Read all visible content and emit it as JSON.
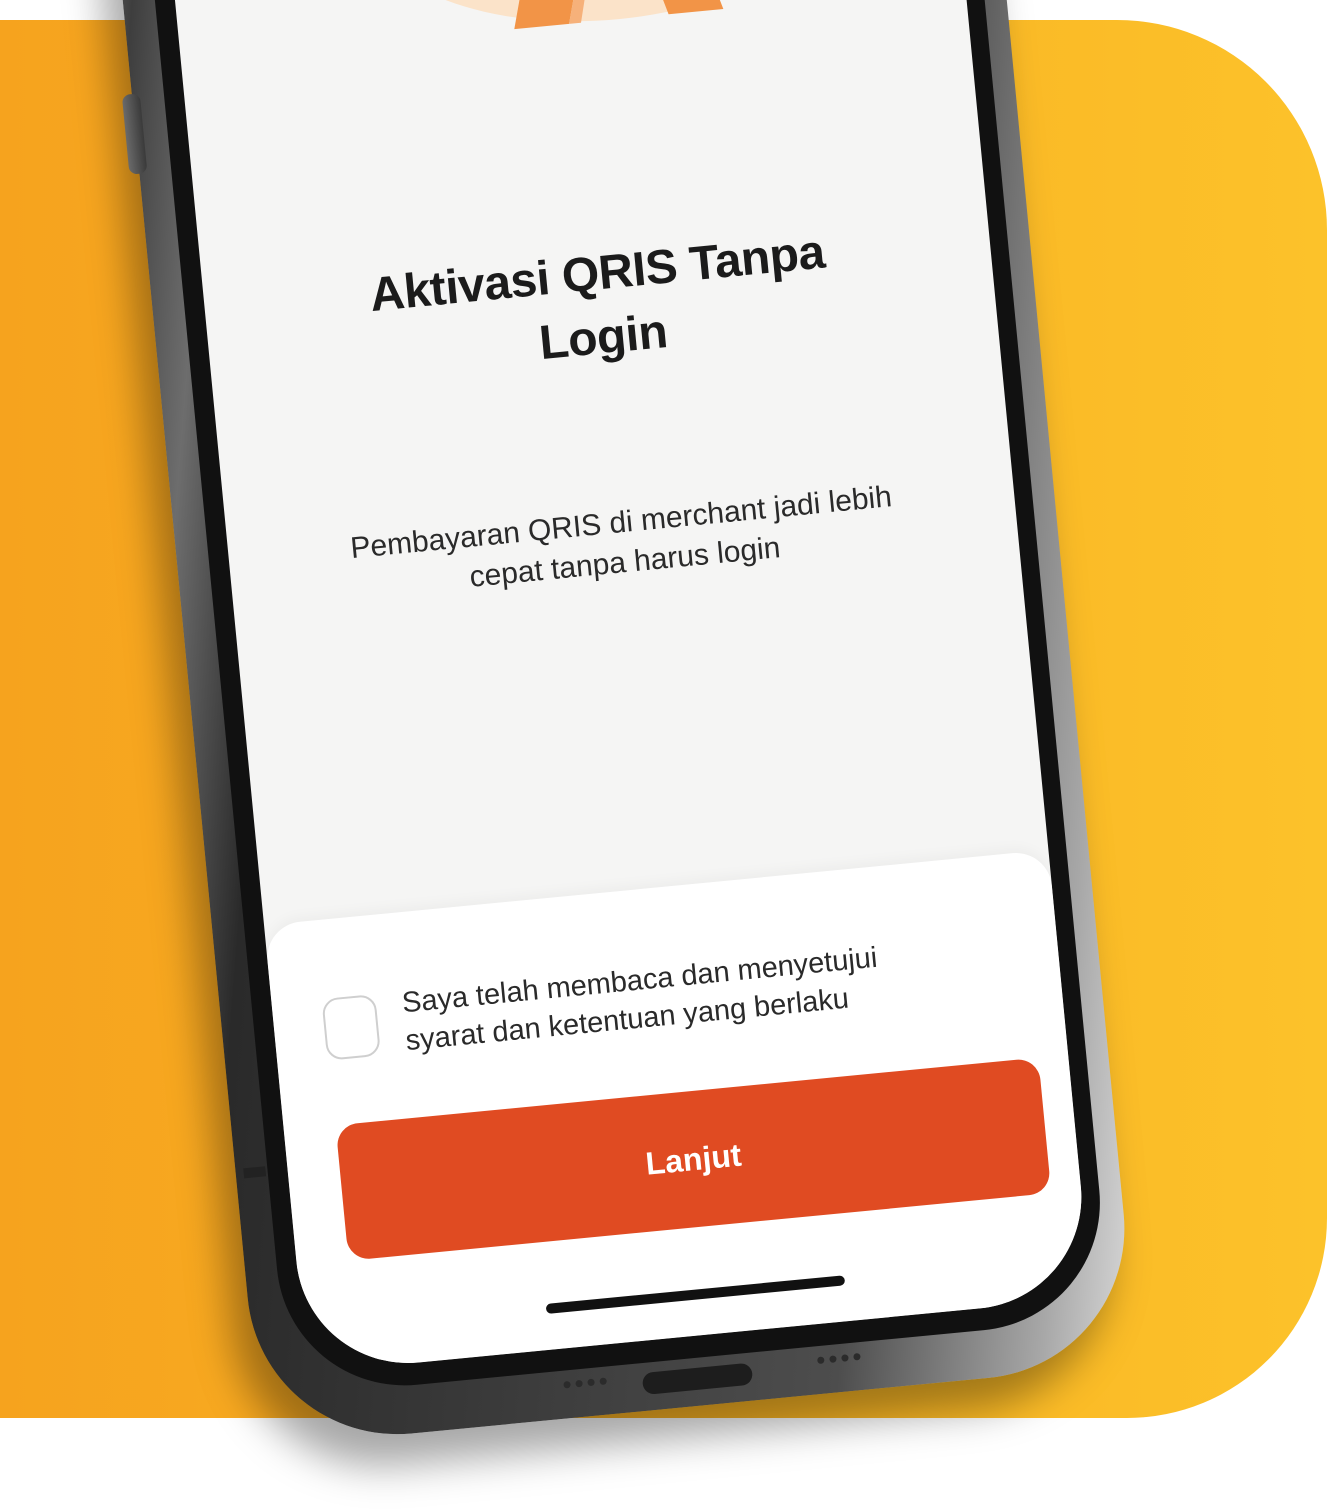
{
  "screen": {
    "title_lines": [
      "Aktivasi QRIS Tanpa",
      "Login"
    ],
    "subtitle_lines": [
      "Pembayaran QRIS di merchant jadi lebih",
      "cepat tanpa harus login"
    ]
  },
  "agreement": {
    "lines": [
      "Saya telah membaca dan menyetujui",
      "syarat dan ketentuan yang berlaku"
    ],
    "checked": false
  },
  "buttons": {
    "continue_label": "Lanjut"
  },
  "colors": {
    "background_left": "#F6A21E",
    "background_right": "#FCC22A",
    "primary": "#E04B22",
    "screen": "#F5F5F4"
  },
  "icons": {
    "checkbox": "checkbox-empty-icon"
  }
}
